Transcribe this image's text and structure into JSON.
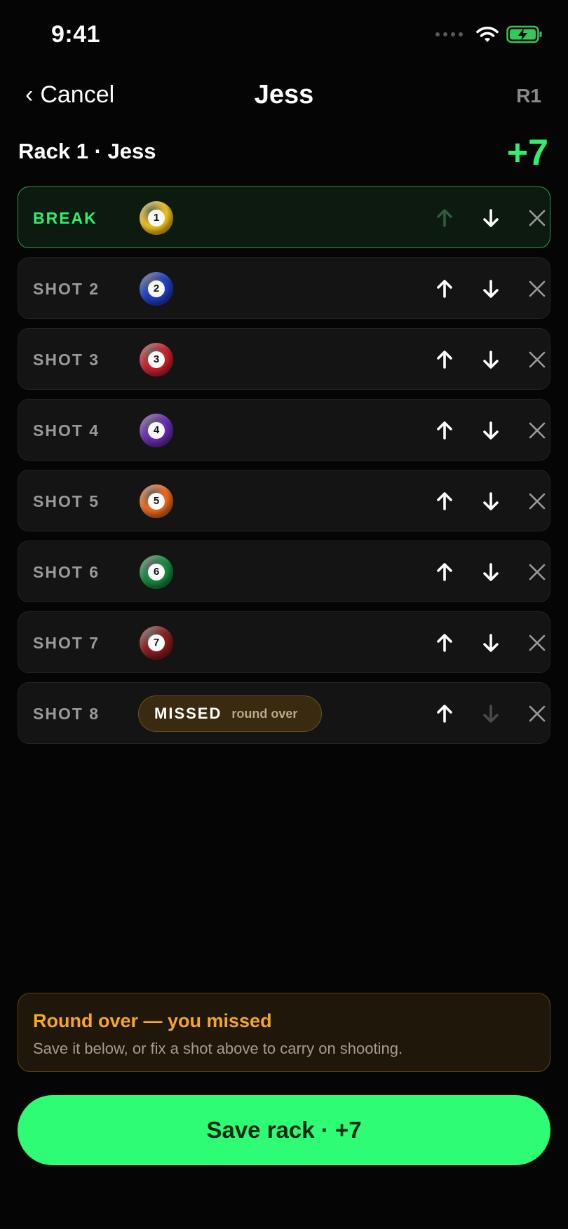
{
  "status_bar": {
    "time": "9:41"
  },
  "nav": {
    "cancel_label": "Cancel",
    "title": "Jess",
    "round": "R1"
  },
  "rack": {
    "title": "Rack 1 · Jess",
    "score": "+7"
  },
  "shots": [
    {
      "label": "BREAK",
      "ball": "1",
      "ball_color": "#f2c21b",
      "up_enabled": false,
      "down_enabled": true,
      "active": true
    },
    {
      "label": "SHOT 2",
      "ball": "2",
      "ball_color": "#1f3fc4",
      "up_enabled": true,
      "down_enabled": true
    },
    {
      "label": "SHOT 3",
      "ball": "3",
      "ball_color": "#cf1f2b",
      "up_enabled": true,
      "down_enabled": true
    },
    {
      "label": "SHOT 4",
      "ball": "4",
      "ball_color": "#6a2cb3",
      "up_enabled": true,
      "down_enabled": true
    },
    {
      "label": "SHOT 5",
      "ball": "5",
      "ball_color": "#ef6b1c",
      "up_enabled": true,
      "down_enabled": true
    },
    {
      "label": "SHOT 6",
      "ball": "6",
      "ball_color": "#168a40",
      "up_enabled": true,
      "down_enabled": true
    },
    {
      "label": "SHOT 7",
      "ball": "7",
      "ball_color": "#8a1c1c",
      "up_enabled": true,
      "down_enabled": true
    },
    {
      "label": "SHOT 8",
      "missed": "MISSED",
      "missed_note": "round over",
      "up_enabled": true,
      "down_enabled": false
    }
  ],
  "notice": {
    "title": "Round over — you missed",
    "text": "Save it below, or fix a shot above to carry on shooting."
  },
  "save_button": {
    "label": "Save rack · +7"
  },
  "colors": {
    "accent": "#2ff06e",
    "warning": "#f5a623",
    "background": "#050505"
  }
}
